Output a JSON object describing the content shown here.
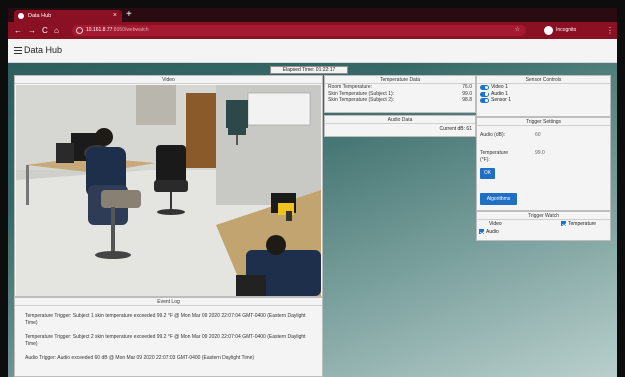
{
  "browser": {
    "tab_title": "Data Hub",
    "tab_close": "×",
    "new_tab": "+",
    "url_host": "10.161.8.77",
    "url_path": ":8050/webwatch",
    "profile_label": "Incognito",
    "nav": {
      "back": "←",
      "forward": "→",
      "reload": "C",
      "home": "⌂",
      "menu": "⋮",
      "url_icons": "☆"
    }
  },
  "app": {
    "title": "Data Hub",
    "elapsed_time": "Elapsed Time: 01:22:17"
  },
  "video": {
    "header": "Video"
  },
  "temperature": {
    "header": "Temperature Data",
    "rows": [
      {
        "label": "Room Temperature:",
        "value": "76.0"
      },
      {
        "label": "Skin Temperature (Subject 1):",
        "value": "99.0"
      },
      {
        "label": "Skin Temperature (Subject 2):",
        "value": "98.8"
      }
    ]
  },
  "audio": {
    "header": "Audio Data",
    "current": "Current dB: 61"
  },
  "sensor_controls": {
    "header": "Sensor Controls",
    "items": [
      "Video 1",
      "Audio 1",
      "Sensor 1"
    ]
  },
  "trigger_settings": {
    "header": "Trigger Settings",
    "audio_label": "Audio (dB):",
    "audio_value": "60",
    "temp_label": "Temperature (°F):",
    "temp_value": "99.0",
    "ok_label": "OK",
    "algorithms_label": "Algorithms"
  },
  "trigger_watch": {
    "header": "Trigger Watch",
    "video_label": "Video",
    "temperature_label": "Temperature",
    "audio_label": "Audio"
  },
  "event_log": {
    "header": "Event Log",
    "entries": [
      "Temperature Trigger: Subject 1 skin temperature exceeded 99.2 °F @ Mon Mar 09 2020 22:07:04 GMT-0400 (Eastern Daylight Time)",
      "Temperature Trigger: Subject 2 skin temperature exceeded 99.2 °F @ Mon Mar 09 2020 22:07:04 GMT-0400 (Eastern Daylight Time)",
      "Audio Trigger: Audio exceeded 60 dB @ Mon Mar 09 2020 22:07:03 GMT-0400 (Eastern Daylight Time)"
    ]
  },
  "colors": {
    "browser_accent": "#8a1024",
    "button_blue": "#1f70c5",
    "page_gradient_dark": "#2d5d5b"
  }
}
